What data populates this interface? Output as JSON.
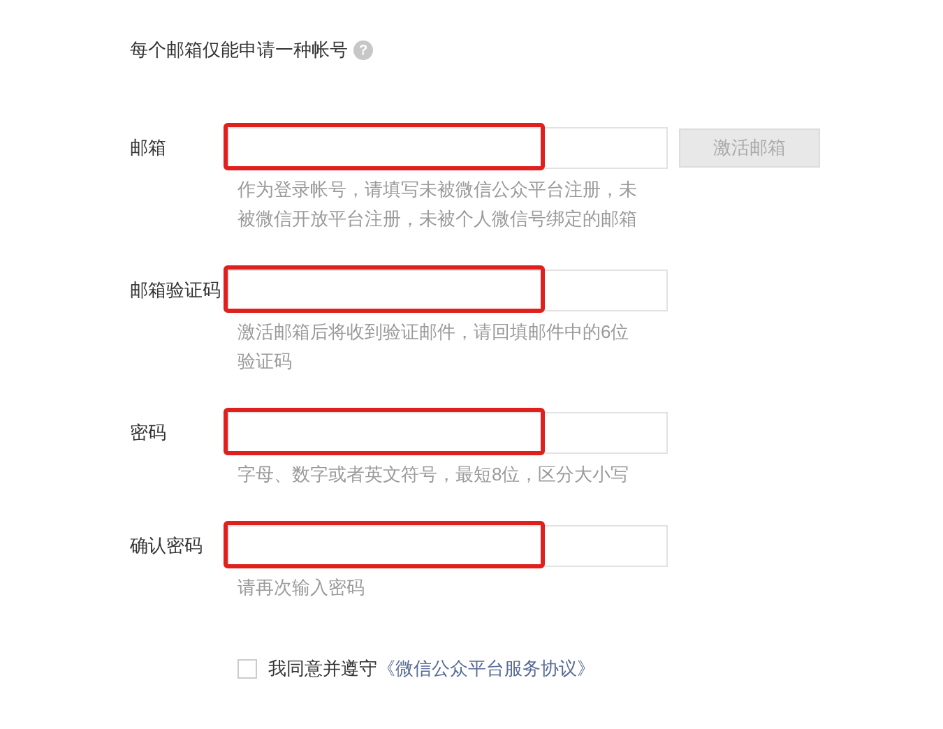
{
  "notice": {
    "text": "每个邮箱仅能申请一种帐号",
    "help": "?"
  },
  "fields": [
    {
      "label": "邮箱",
      "hint": "作为登录帐号，请填写未被微信公众平台注册，未被微信开放平台注册，未被个人微信号绑定的邮箱",
      "highlighted": true,
      "button": {
        "label": "激活邮箱",
        "disabled": true
      }
    },
    {
      "label": "邮箱验证码",
      "hint": "激活邮箱后将收到验证邮件，请回填邮件中的6位验证码",
      "highlighted": true
    },
    {
      "label": "密码",
      "hint": "字母、数字或者英文符号，最短8位，区分大小写",
      "highlighted": true
    },
    {
      "label": "确认密码",
      "hint": "请再次输入密码",
      "highlighted": true
    }
  ],
  "agreement": {
    "checked": false,
    "text": "我同意并遵守",
    "link": "《微信公众平台服务协议》"
  }
}
